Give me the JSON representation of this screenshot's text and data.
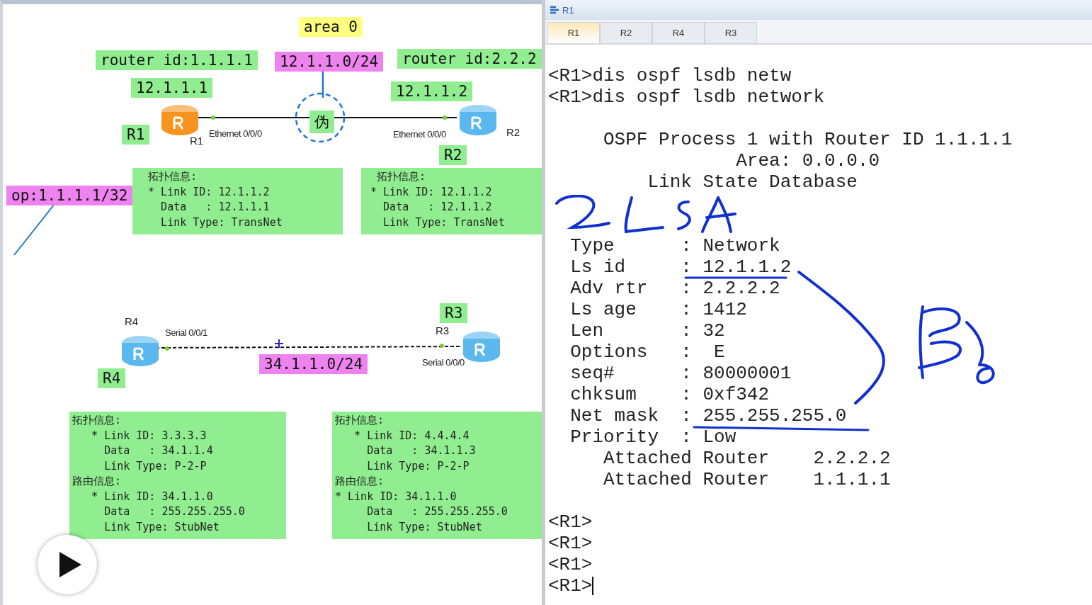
{
  "topology": {
    "labels": [
      {
        "text": "area 0",
        "color": "#ffff80"
      },
      {
        "text": "router id:1.1.1.1",
        "color": "#90ee90"
      },
      {
        "text": "12.1.1.0/24",
        "color": "#ee82ee"
      },
      {
        "text": "router id:2.2.2",
        "color": "#90ee90"
      },
      {
        "text": "12.1.1.1",
        "color": "#90ee90"
      },
      {
        "text": "12.1.1.2",
        "color": "#90ee90"
      },
      {
        "text": "R1",
        "color": "#90ee90"
      },
      {
        "text": "伪",
        "color": "#90ee90"
      },
      {
        "text": "R2",
        "color": "#90ee90"
      },
      {
        "text": "op:1.1.1.1/32",
        "color": "#ee82ee"
      },
      {
        "text": "R3",
        "color": "#90ee90"
      },
      {
        "text": "34.1.1.0/24",
        "color": "#ee82ee"
      },
      {
        "text": "R4",
        "color": "#90ee90"
      }
    ],
    "routers": [
      {
        "name": "R1",
        "color": "#f7931e"
      },
      {
        "name": "R2",
        "color": "#5bb8ee"
      },
      {
        "name": "R4",
        "color": "#5bb8ee"
      },
      {
        "name": "R3",
        "color": "#5bb8ee"
      }
    ],
    "ports": [
      "Ethernet 0/0/0",
      "Ethernet 0/0/0",
      "Serial 0/0/1",
      "Serial 0/0/0"
    ],
    "info_boxes": [
      {
        "lines": [
          "  拓扑信息:",
          "  * Link ID: 12.1.1.2",
          "    Data   : 12.1.1.1",
          "    Link Type: TransNet"
        ]
      },
      {
        "lines": [
          "  拓扑信息:",
          " * Link ID: 12.1.1.2",
          "   Data   : 12.1.1.2",
          "   Link Type: TransNet"
        ]
      },
      {
        "lines": [
          "拓扑信息:",
          "   * Link ID: 3.3.3.3",
          "     Data   : 34.1.1.4",
          "     Link Type: P-2-P",
          "路由信息:",
          "   * Link ID: 34.1.1.0",
          "     Data   : 255.255.255.0",
          "     Link Type: StubNet"
        ]
      },
      {
        "lines": [
          "拓扑信息:",
          "   * Link ID: 4.4.4.4",
          "     Data   : 34.1.1.3",
          "     Link Type: P-2-P",
          "路由信息:",
          "* Link ID: 34.1.1.0",
          "     Data   : 255.255.255.0",
          "     Link Type: StubNet"
        ]
      }
    ]
  },
  "terminal": {
    "title": "R1",
    "tabs": [
      {
        "label": "R1",
        "selected": true
      },
      {
        "label": "R2",
        "selected": false
      },
      {
        "label": "R4",
        "selected": false
      },
      {
        "label": "R3",
        "selected": false
      }
    ],
    "blocks": [
      {
        "lines": [
          "<R1>dis ospf lsdb netw",
          "<R1>dis ospf lsdb network"
        ]
      },
      {
        "lines": [
          "     OSPF Process 1 with Router ID 1.1.1.1",
          "                 Area: 0.0.0.0",
          "         Link State Database"
        ]
      },
      {
        "lines": [
          "  Type      : Network",
          "  Ls id     : 12.1.1.2",
          "  Adv rtr   : 2.2.2.2",
          "  Ls age    : 1412",
          "  Len       : 32",
          "  Options   :  E",
          "  seq#      : 80000001",
          "  chksum    : 0xf342",
          "  Net mask  : 255.255.255.0",
          "  Priority  : Low",
          "     Attached Router    2.2.2.2",
          "     Attached Router    1.1.1.1"
        ]
      },
      {
        "lines": [
          "<R1>",
          "<R1>",
          "<R1>",
          "<R1>"
        ]
      }
    ],
    "cursor": true
  }
}
